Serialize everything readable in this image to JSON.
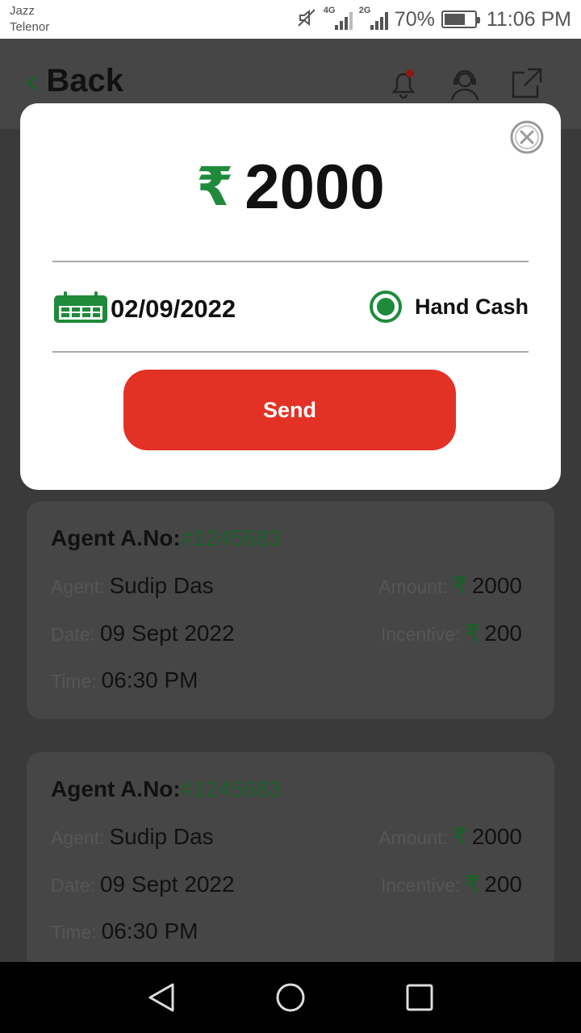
{
  "status_bar": {
    "carrier_1": "Jazz",
    "carrier_2": "Telenor",
    "net_1": "4G",
    "net_2": "2G",
    "battery_pct": "70%",
    "battery_level": 0.7,
    "time": "11:06 PM",
    "icons": [
      "mute-icon",
      "signal-icon",
      "battery-icon"
    ]
  },
  "header": {
    "back_label": "Back",
    "icons": [
      "notification-bell-icon",
      "support-agent-icon",
      "share-external-icon"
    ]
  },
  "modal": {
    "currency_symbol": "₹",
    "amount": "2000",
    "date": "02/09/2022",
    "payment_method": "Hand Cash",
    "payment_selected": true,
    "send_label": "Send",
    "accent_color": "#1e8a3a",
    "button_color": "#e33125"
  },
  "cards": [
    {
      "account_label": "Agent A.No:",
      "account_no": "#1245683",
      "agent_label": "Agent:",
      "agent_name": "Sudip Das",
      "amount_label": "Amount:",
      "currency_symbol": "₹",
      "amount": "2000",
      "date_label": "Date:",
      "date": "09 Sept 2022",
      "incentive_label": "Incentive:",
      "incentive": "200",
      "time_label": "Time:",
      "time": "06:30 PM"
    },
    {
      "account_label": "Agent A.No:",
      "account_no": "#1245683",
      "agent_label": "Agent:",
      "agent_name": "Sudip Das",
      "amount_label": "Amount:",
      "currency_symbol": "₹",
      "amount": "2000",
      "date_label": "Date:",
      "date": "09 Sept 2022",
      "incentive_label": "Incentive:",
      "incentive": "200",
      "time_label": "Time:",
      "time": "06:30 PM"
    }
  ],
  "nav": {
    "icons": [
      "back-triangle-icon",
      "home-circle-icon",
      "recents-square-icon"
    ]
  }
}
